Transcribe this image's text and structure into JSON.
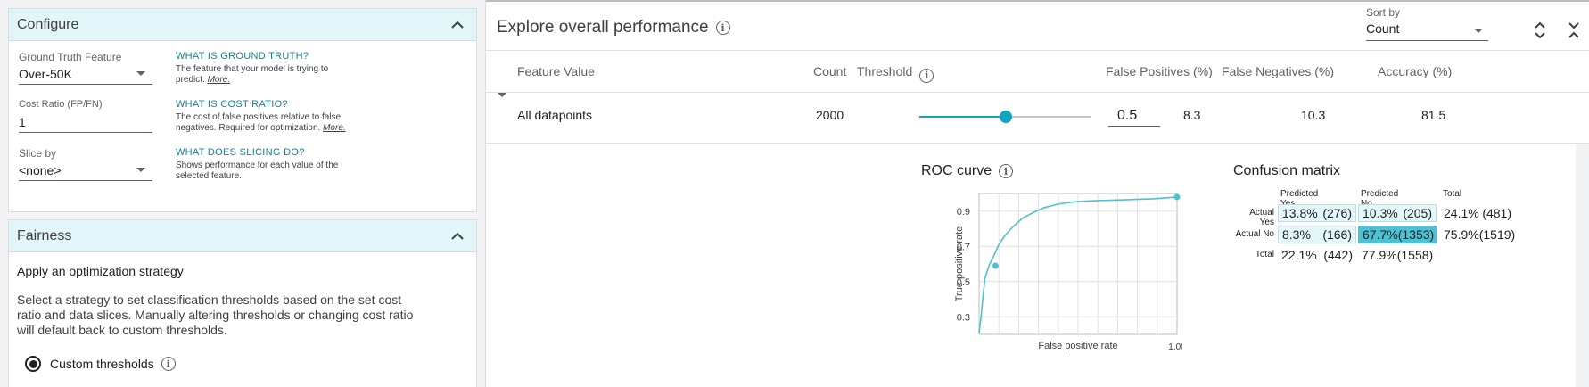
{
  "configure": {
    "title": "Configure",
    "ground_truth": {
      "label": "Ground Truth Feature",
      "value": "Over-50K",
      "help_title": "WHAT IS GROUND TRUTH?",
      "help_text": "The feature that your model is trying to predict.",
      "help_more": "More."
    },
    "cost_ratio": {
      "label": "Cost Ratio (FP/FN)",
      "value": "1",
      "help_title": "WHAT IS COST RATIO?",
      "help_text": "The cost of false positives relative to false negatives. Required for optimization.",
      "help_more": "More."
    },
    "slice_by": {
      "label": "Slice by",
      "value": "<none>",
      "help_title": "WHAT DOES SLICING DO?",
      "help_text": "Shows performance for each value of the selected feature."
    }
  },
  "fairness": {
    "title": "Fairness",
    "heading": "Apply an optimization strategy",
    "description": "Select a strategy to set classification thresholds based on the set cost ratio and data slices. Manually altering thresholds or changing cost ratio will default back to custom thresholds.",
    "option_label": "Custom thresholds",
    "option_selected": true
  },
  "explore": {
    "title": "Explore overall performance",
    "sort_label": "Sort by",
    "sort_value": "Count"
  },
  "table": {
    "headers": {
      "feature_value": "Feature Value",
      "count": "Count",
      "threshold": "Threshold",
      "false_positives": "False Positives (%)",
      "false_negatives": "False Negatives (%)",
      "accuracy": "Accuracy (%)"
    },
    "row": {
      "feature_value": "All datapoints",
      "count": "2000",
      "threshold": "0.5",
      "threshold_fraction": 0.5,
      "false_positives": "8.3",
      "false_negatives": "10.3",
      "accuracy": "81.5"
    }
  },
  "roc": {
    "title": "ROC curve",
    "ylabel": "True positive rate",
    "xlabel": "False positive rate",
    "y_ticks": [
      "0.9",
      "0.7",
      "0.5",
      "0.3"
    ],
    "x_tick_end": "1.00",
    "line_color": "#4fc1d4"
  },
  "chart_data": {
    "type": "line",
    "title": "ROC curve",
    "xlabel": "False positive rate",
    "ylabel": "True positive rate",
    "xlim": [
      0,
      1
    ],
    "ylim": [
      0.2,
      1.0
    ],
    "grid": true,
    "series": [
      {
        "x": [
          0.0,
          0.01,
          0.02,
          0.03,
          0.05,
          0.08,
          0.1,
          0.13,
          0.17,
          0.22,
          0.27,
          0.33,
          0.4,
          0.5,
          0.6,
          0.75,
          0.88,
          1.0
        ],
        "y": [
          0.21,
          0.3,
          0.42,
          0.52,
          0.59,
          0.66,
          0.71,
          0.76,
          0.81,
          0.86,
          0.89,
          0.92,
          0.94,
          0.955,
          0.96,
          0.965,
          0.97,
          0.98
        ]
      }
    ],
    "markers": [
      {
        "x": 0.083,
        "y": 0.59
      },
      {
        "x": 1.0,
        "y": 0.98
      }
    ]
  },
  "confusion": {
    "title": "Confusion matrix",
    "col_headers": [
      "Predicted Yes",
      "Predicted No",
      "Total"
    ],
    "row_headers": [
      "Actual Yes",
      "Actual No",
      "Total"
    ],
    "cells": [
      [
        {
          "pct": "13.8%",
          "n": "(276)"
        },
        {
          "pct": "10.3%",
          "n": "(205)"
        },
        {
          "pct": "24.1%",
          "n": "(481)"
        }
      ],
      [
        {
          "pct": "8.3%",
          "n": "(166)"
        },
        {
          "pct": "67.7%",
          "n": "(1353)"
        },
        {
          "pct": "75.9%",
          "n": "(1519)"
        }
      ],
      [
        {
          "pct": "22.1%",
          "n": "(442)"
        },
        {
          "pct": "77.9%",
          "n": "(1558)"
        },
        {
          "pct": "",
          "n": ""
        }
      ]
    ],
    "light_color": "#e3f6f9",
    "dark_color": "#4fc1d4"
  }
}
